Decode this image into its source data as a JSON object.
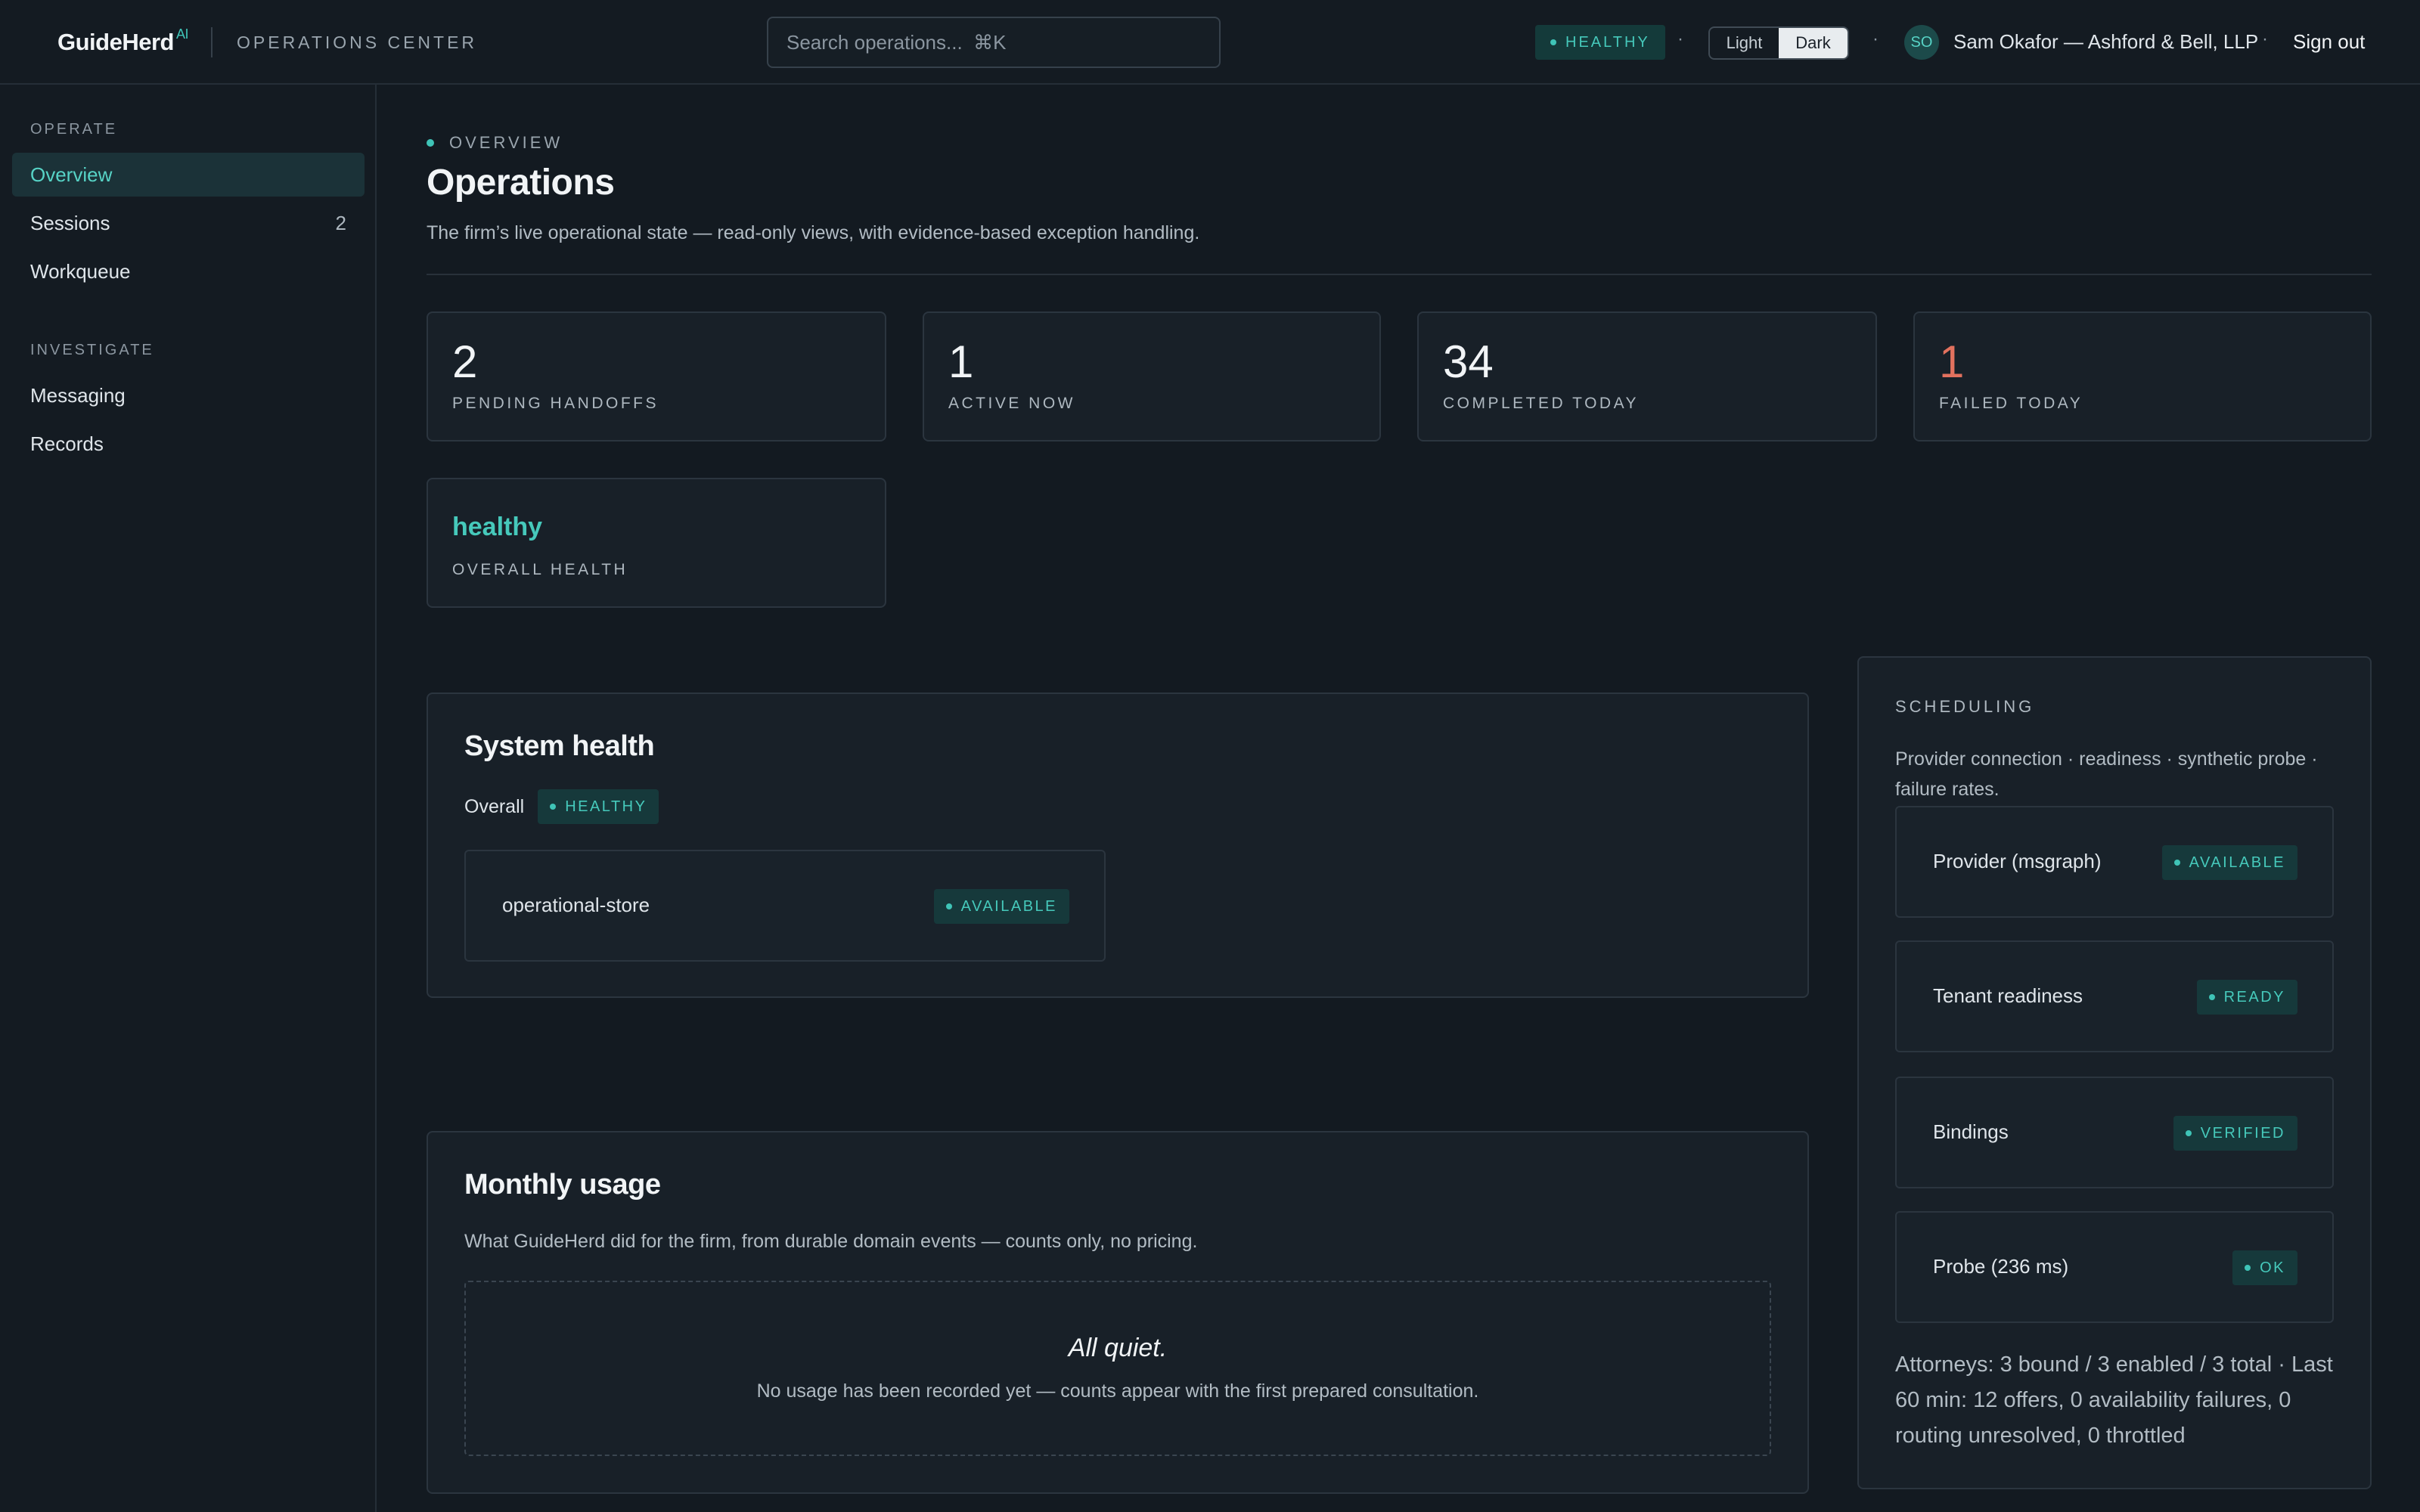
{
  "app": {
    "brand": "GuideHerd",
    "brand_suffix": "AI",
    "section_title": "OPERATIONS CENTER"
  },
  "header": {
    "search_placeholder": "Search operations...  ⌘K",
    "health_status": "HEALTHY",
    "separator": "·",
    "theme_light": "Light",
    "theme_dark": "Dark",
    "theme_selected": "Dark",
    "avatar_initials": "SO",
    "user": "Sam Okafor — Ashford & Bell, LLP",
    "sign_out": "Sign out"
  },
  "sidebar": {
    "sections": [
      {
        "title": "OPERATE",
        "items": [
          {
            "label": "Overview",
            "active": true,
            "count": ""
          },
          {
            "label": "Sessions",
            "active": false,
            "count": "2"
          },
          {
            "label": "Workqueue",
            "active": false,
            "count": ""
          }
        ]
      },
      {
        "title": "INVESTIGATE",
        "items": [
          {
            "label": "Messaging",
            "active": false,
            "count": ""
          },
          {
            "label": "Records",
            "active": false,
            "count": ""
          }
        ]
      }
    ]
  },
  "page": {
    "eyebrow": "OVERVIEW",
    "title": "Operations",
    "subtitle": "The firm’s live operational state — read-only views, with evidence-based exception handling."
  },
  "stats": [
    {
      "value": "2",
      "label": "PENDING HANDOFFS"
    },
    {
      "value": "1",
      "label": "ACTIVE NOW"
    },
    {
      "value": "34",
      "label": "COMPLETED TODAY"
    },
    {
      "value": "1",
      "label": "FAILED TODAY"
    },
    {
      "value": "healthy",
      "label": "OVERALL HEALTH"
    }
  ],
  "system_health": {
    "title": "System health",
    "overall_label": "Overall",
    "overall_status": "HEALTHY",
    "components": [
      {
        "name": "operational-store",
        "status": "AVAILABLE"
      }
    ]
  },
  "monthly_usage": {
    "title": "Monthly usage",
    "description": "What GuideHerd did for the firm, from durable domain events — counts only, no pricing.",
    "empty_title": "All quiet.",
    "empty_description": "No usage has been recorded yet — counts appear with the first prepared consultation."
  },
  "scheduling": {
    "heading": "SCHEDULING",
    "description": "Provider connection · readiness · synthetic probe · failure rates.",
    "checks": [
      {
        "label": "Provider (msgraph)",
        "status": "AVAILABLE"
      },
      {
        "label": "Tenant readiness",
        "status": "READY"
      },
      {
        "label": "Bindings",
        "status": "VERIFIED"
      },
      {
        "label": "Probe (236 ms)",
        "status": "OK"
      }
    ],
    "summary": "Attorneys: 3 bound / 3 enabled / 3 total · Last 60 min: 12 offers, 0 availability failures, 0 routing unresolved, 0 throttled"
  },
  "colors": {
    "accent": "#46c9bb",
    "danger": "#e2715e",
    "background": "#131a21",
    "badge_bg": "#16393b"
  }
}
